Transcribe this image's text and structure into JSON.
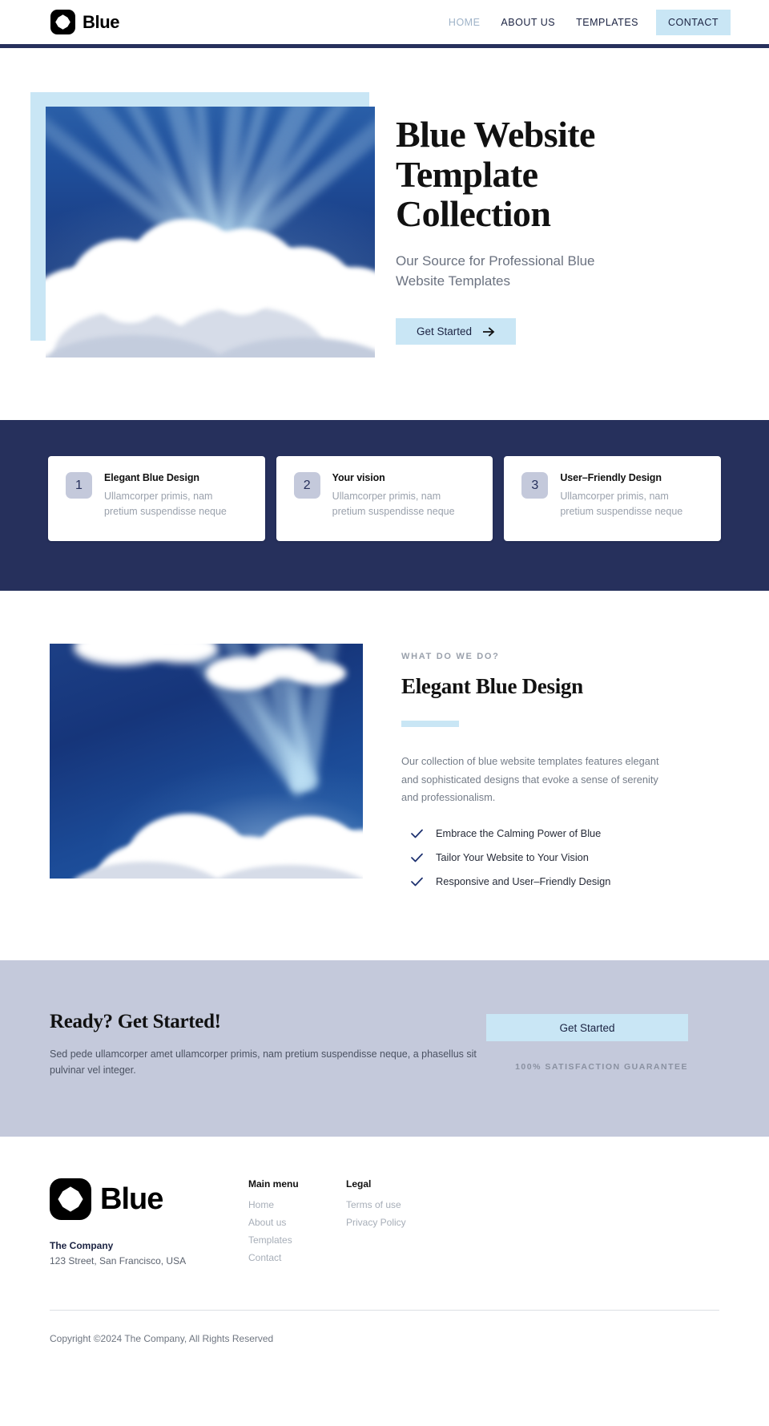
{
  "header": {
    "brand_name": "Blue",
    "logo_icon": "blue-logo-icon",
    "nav": [
      {
        "label": "HOME",
        "state": "muted"
      },
      {
        "label": "ABOUT US",
        "state": "default"
      },
      {
        "label": "TEMPLATES",
        "state": "default"
      },
      {
        "label": "CONTACT",
        "state": "cta"
      }
    ]
  },
  "hero": {
    "title": "Blue Website Template Collection",
    "subtitle": "Our Source for Professional Blue Website Templates",
    "button_label": "Get Started",
    "button_icon": "arrow-right-icon",
    "image_alt": "sunbeams behind a large white cumulus cloud in a deep blue sky",
    "accent_color": "#c9e6f5"
  },
  "steps": {
    "band_color": "#26305c",
    "cards": [
      {
        "number": "1",
        "title": "Elegant Blue Design",
        "description": "Ullamcorper primis, nam pretium suspendisse neque"
      },
      {
        "number": "2",
        "title": "Your vision",
        "description": "Ullamcorper primis, nam pretium suspendisse neque"
      },
      {
        "number": "3",
        "title": "User–Friendly Design",
        "description": "Ullamcorper primis, nam pretium suspendisse neque"
      }
    ]
  },
  "about": {
    "eyebrow": "WHAT DO WE DO?",
    "title": "Elegant Blue Design",
    "body": "Our collection of blue website templates features elegant and sophisticated designs that evoke a sense of serenity and professionalism.",
    "image_alt": "blue sky with sunbeams and white clouds",
    "checklist": [
      "Embrace the Calming Power of Blue",
      "Tailor Your Website to Your Vision",
      "Responsive and User–Friendly Design"
    ],
    "check_icon": "check-icon"
  },
  "cta": {
    "title": "Ready? Get Started!",
    "body": "Sed pede ullamcorper amet ullamcorper primis, nam pretium suspendisse neque, a phasellus sit pulvinar vel integer.",
    "button_label": "Get Started",
    "guarantee": "100% SATISFACTION GUARANTEE",
    "band_color": "#c4c9db"
  },
  "footer": {
    "brand_name": "Blue",
    "logo_icon": "blue-logo-icon",
    "company_name": "The Company",
    "address": "123 Street, San Francisco, USA",
    "columns": [
      {
        "title": "Main menu",
        "links": [
          "Home",
          "About us",
          "Templates",
          "Contact"
        ]
      },
      {
        "title": "Legal",
        "links": [
          "Terms of use",
          "Privacy Policy"
        ]
      }
    ],
    "copyright": "Copyright ©2024 The Company, All Rights Reserved"
  }
}
